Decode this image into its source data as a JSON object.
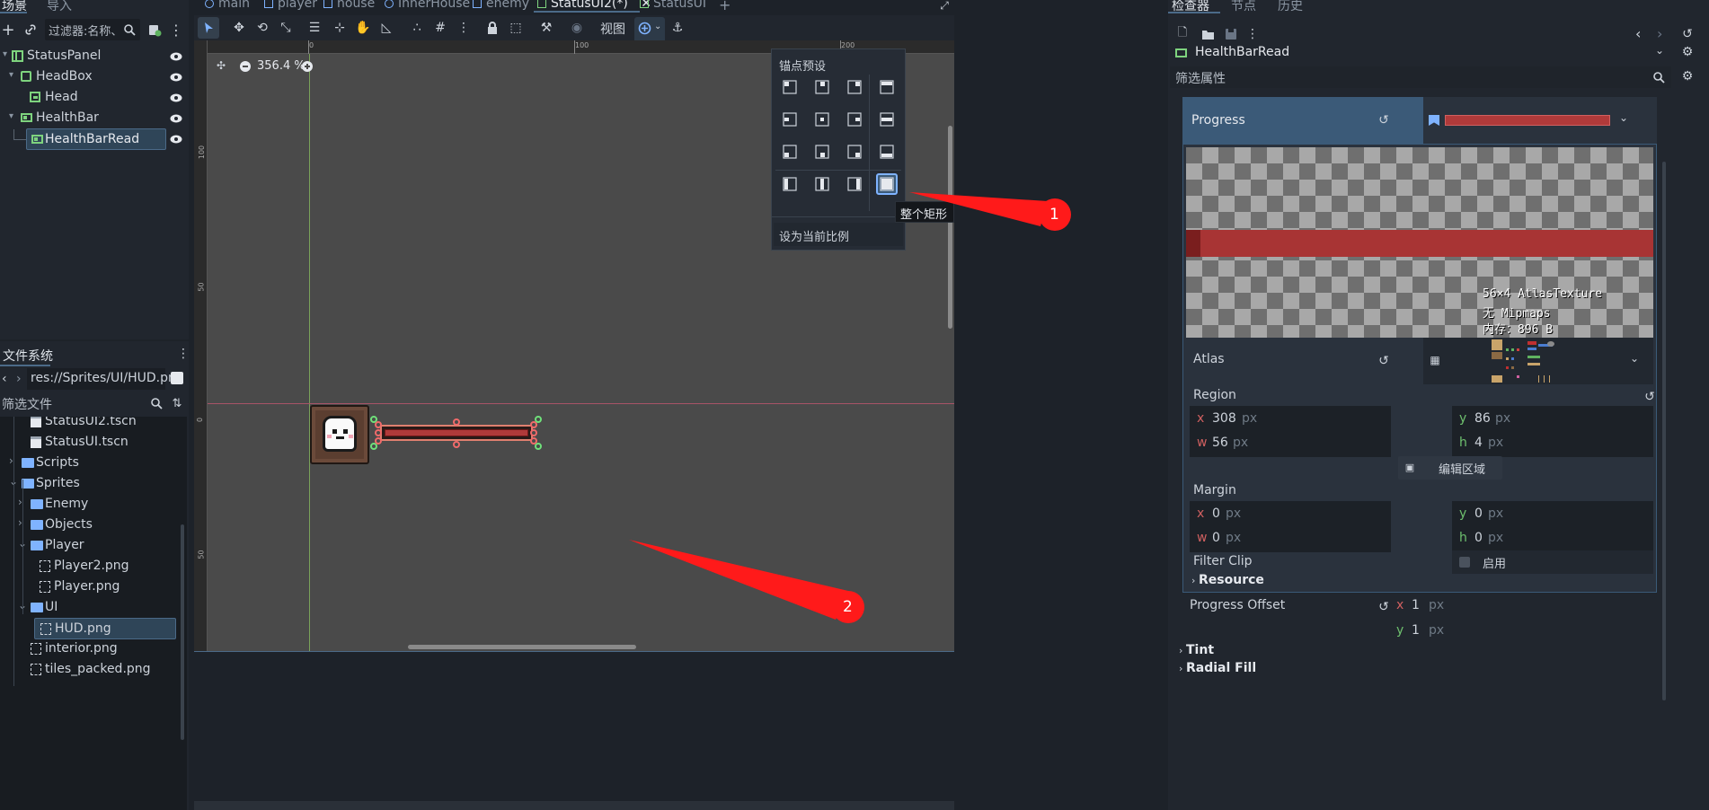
{
  "left_dock": {
    "tabs": [
      "场景",
      "导入"
    ],
    "filter_placeholder": "过滤器:名称、t:",
    "tree": [
      {
        "label": "StatusPanel",
        "icon": "panel-container-icon"
      },
      {
        "label": "HeadBox",
        "icon": "control-box-icon"
      },
      {
        "label": "Head",
        "icon": "texture-rect-icon"
      },
      {
        "label": "HealthBar",
        "icon": "progress-bar-icon"
      },
      {
        "label": "HealthBarRead",
        "icon": "progress-bar-icon"
      }
    ]
  },
  "filesystem": {
    "title": "文件系统",
    "path": "res://Sprites/UI/HUD.png",
    "filter_placeholder": "筛选文件",
    "items": [
      {
        "label": "StatusUI2.tscn",
        "icon": "scene-file-icon"
      },
      {
        "label": "StatusUI.tscn",
        "icon": "scene-file-icon"
      },
      {
        "label": "Scripts",
        "icon": "folder-icon"
      },
      {
        "label": "Sprites",
        "icon": "folder-icon"
      },
      {
        "label": "Enemy",
        "icon": "folder-icon"
      },
      {
        "label": "Objects",
        "icon": "folder-icon"
      },
      {
        "label": "Player",
        "icon": "folder-icon"
      },
      {
        "label": "Player2.png",
        "icon": "image-file-icon"
      },
      {
        "label": "Player.png",
        "icon": "image-file-icon"
      },
      {
        "label": "UI",
        "icon": "folder-icon"
      },
      {
        "label": "HUD.png",
        "icon": "image-file-icon"
      },
      {
        "label": "interior.png",
        "icon": "image-file-icon"
      },
      {
        "label": "tiles_packed.png",
        "icon": "image-file-icon"
      }
    ]
  },
  "editor_tabs": [
    "main",
    "player",
    "house",
    "InnerHouse",
    "enemy",
    "StatusUI2(*)",
    "StatusUI"
  ],
  "toolbar": {
    "view_label": "视图"
  },
  "viewport": {
    "zoom": "356.4 %",
    "ruler_top": [
      "0",
      "100",
      "200"
    ],
    "ruler_left": [
      "100",
      "50",
      "0",
      "50"
    ]
  },
  "anchor_popup": {
    "title": "锚点预设",
    "tooltip": "整个矩形",
    "ratio_label": "设为当前比例"
  },
  "annotations": [
    "1",
    "2"
  ],
  "inspector": {
    "tabs": [
      "检查器",
      "节点",
      "历史"
    ],
    "node_name": "HealthBarRead",
    "filter_placeholder": "筛选属性",
    "progress_label": "Progress",
    "texture_info": [
      "56×4 AtlasTexture",
      "无 Mipmaps",
      "内存：896 B"
    ],
    "atlas_label": "Atlas",
    "region_label": "Region",
    "region": {
      "x": "308",
      "y": "86",
      "w": "56",
      "h": "4"
    },
    "unit": "px",
    "edit_region_label": "编辑区域",
    "margin_label": "Margin",
    "margin": {
      "x": "0",
      "y": "0",
      "w": "0",
      "h": "0"
    },
    "filter_clip_label": "Filter Clip",
    "filter_clip_value": "启用",
    "resource_label": "Resource",
    "progress_offset_label": "Progress Offset",
    "progress_offset": {
      "x": "1",
      "y": "1"
    },
    "tint_label": "Tint",
    "radial_fill_label": "Radial Fill"
  },
  "colors": {
    "accent": "#4b6a88",
    "bar_red": "#b03a3a",
    "annotation_red": "#ff1a1a"
  }
}
